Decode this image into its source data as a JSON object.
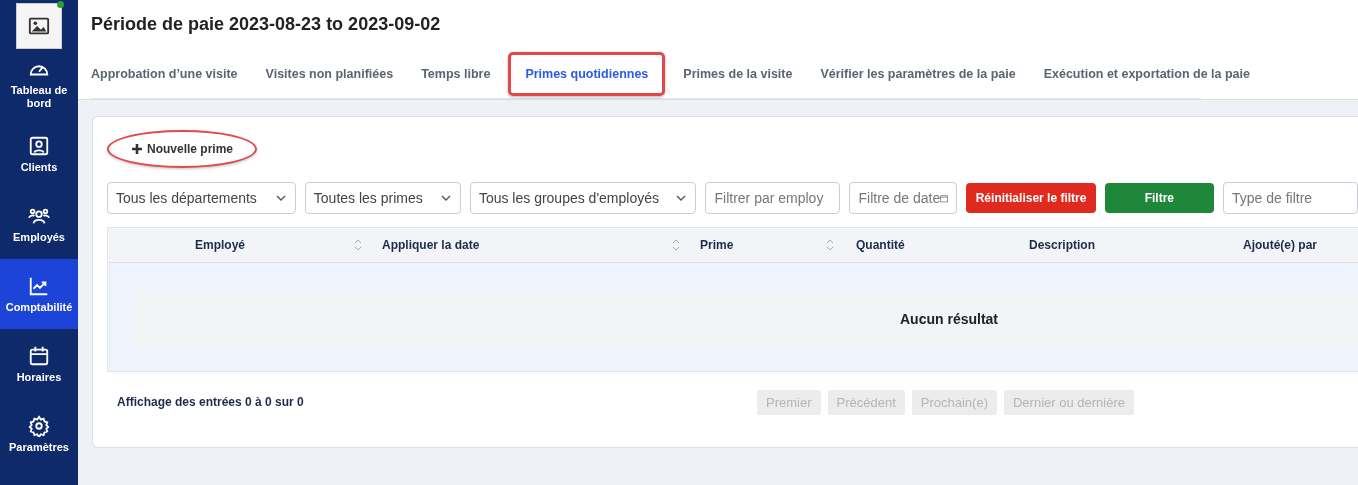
{
  "sidebar": {
    "online": true,
    "items": [
      {
        "label": "Tableau de bord",
        "selected": false
      },
      {
        "label": "Clients",
        "selected": false
      },
      {
        "label": "Employés",
        "selected": false
      },
      {
        "label": "Comptabilité",
        "selected": true
      },
      {
        "label": "Horaires",
        "selected": false
      },
      {
        "label": "Paramètres",
        "selected": false
      }
    ]
  },
  "title": "Période de paie 2023-08-23 to 2023-09-02",
  "tabs": [
    {
      "label": "Approbation d’une visite",
      "selected": false,
      "annotated": false
    },
    {
      "label": "Visites non planifiées",
      "selected": false,
      "annotated": false
    },
    {
      "label": "Temps libre",
      "selected": false,
      "annotated": false
    },
    {
      "label": "Primes quotidiennes",
      "selected": true,
      "annotated": true
    },
    {
      "label": "Primes de la visite",
      "selected": false,
      "annotated": false
    },
    {
      "label": "Vérifier les paramètres de la paie",
      "selected": false,
      "annotated": false
    },
    {
      "label": "Exécution et exportation de la paie",
      "selected": false,
      "annotated": false
    }
  ],
  "new_button": {
    "label": "Nouvelle prime",
    "annotated": true
  },
  "filters": [
    {
      "kind": "select",
      "value": "Tous les départements"
    },
    {
      "kind": "select",
      "value": "Toutes les primes"
    },
    {
      "kind": "select",
      "value": "Tous les groupes d'employés"
    },
    {
      "kind": "input",
      "placeholder": "Filtrer par employ"
    },
    {
      "kind": "date",
      "placeholder": "Filtre de date"
    },
    {
      "kind": "reset",
      "label": "Réinitialiser le filtre"
    },
    {
      "kind": "apply",
      "label": "Filtre"
    },
    {
      "kind": "input",
      "placeholder": "Type de filtre"
    }
  ],
  "table": {
    "columns": [
      {
        "label": "Employé",
        "sortable": true
      },
      {
        "label": "Appliquer la date",
        "sortable": true
      },
      {
        "label": "Prime",
        "sortable": true
      },
      {
        "label": "Quantité",
        "sortable": false
      },
      {
        "label": "Description",
        "sortable": false
      },
      {
        "label": "Ajouté(e) par",
        "sortable": false
      }
    ],
    "empty": "Aucun résultat"
  },
  "entries_info": "Affichage des entrées 0 à 0 sur 0",
  "pagination": [
    {
      "label": "Premier",
      "disabled": true
    },
    {
      "label": "Précédent",
      "disabled": true
    },
    {
      "label": "Prochain(e)",
      "disabled": true
    },
    {
      "label": "Dernier ou dernière",
      "disabled": true
    }
  ]
}
